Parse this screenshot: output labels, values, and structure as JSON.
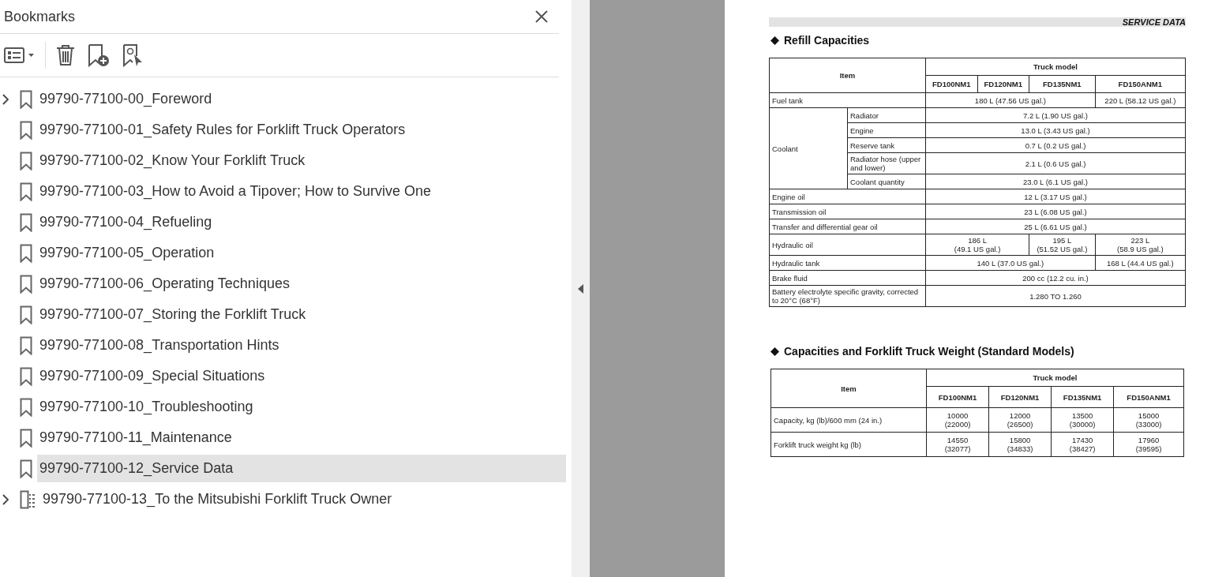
{
  "panel": {
    "title": "Bookmarks"
  },
  "bookmarks": [
    {
      "label": "99790-77100-00_Foreword",
      "kind": "bookmark",
      "has_children": true,
      "selected": false
    },
    {
      "label": "99790-77100-01_Safety Rules for Forklift Truck Operators",
      "kind": "bookmark",
      "has_children": false,
      "selected": false
    },
    {
      "label": "99790-77100-02_Know Your Forklift Truck",
      "kind": "bookmark",
      "has_children": false,
      "selected": false
    },
    {
      "label": "99790-77100-03_How to Avoid a Tipover; How to Survive One",
      "kind": "bookmark",
      "has_children": false,
      "selected": false
    },
    {
      "label": "99790-77100-04_Refueling",
      "kind": "bookmark",
      "has_children": false,
      "selected": false
    },
    {
      "label": "99790-77100-05_Operation",
      "kind": "bookmark",
      "has_children": false,
      "selected": false
    },
    {
      "label": "99790-77100-06_Operating Techniques",
      "kind": "bookmark",
      "has_children": false,
      "selected": false
    },
    {
      "label": "99790-77100-07_Storing the Forklift Truck",
      "kind": "bookmark",
      "has_children": false,
      "selected": false
    },
    {
      "label": "99790-77100-08_Transportation Hints",
      "kind": "bookmark",
      "has_children": false,
      "selected": false
    },
    {
      "label": "99790-77100-09_Special Situations",
      "kind": "bookmark",
      "has_children": false,
      "selected": false
    },
    {
      "label": "99790-77100-10_Troubleshooting",
      "kind": "bookmark",
      "has_children": false,
      "selected": false
    },
    {
      "label": "99790-77100-11_Maintenance",
      "kind": "bookmark",
      "has_children": false,
      "selected": false
    },
    {
      "label": "99790-77100-12_Service Data",
      "kind": "bookmark",
      "has_children": false,
      "selected": true
    },
    {
      "label": "99790-77100-13_To the Mitsubishi Forklift Truck Owner",
      "kind": "document",
      "has_children": true,
      "selected": false
    }
  ],
  "document": {
    "header": "SERVICE DATA",
    "refill": {
      "heading": "Refill Capacities",
      "item_header": "Item",
      "group_header": "Truck model",
      "models": [
        "FD100NM1",
        "FD120NM1",
        "FD135NM1",
        "FD150ANM1"
      ],
      "rows": [
        {
          "label": "Fuel tank",
          "values": [
            "180 L (47.56 US gal.)",
            "220 L (58.12 US gal.)"
          ]
        },
        {
          "label": "Coolant",
          "children": [
            {
              "label": "Radiator",
              "values": [
                "7.2 L (1.90 US gal.)"
              ]
            },
            {
              "label": "Engine",
              "values": [
                "13.0 L (3.43 US gal.)"
              ]
            },
            {
              "label": "Reserve tank",
              "values": [
                "0.7 L (0.2 US gal.)"
              ]
            },
            {
              "label": "Radiator hose (upper and lower)",
              "values": [
                "2.1 L (0.6 US gal.)"
              ]
            },
            {
              "label": "Coolant quantity",
              "values": [
                "23.0 L (6.1 US gal.)"
              ]
            }
          ]
        },
        {
          "label": "Engine oil",
          "values": [
            "12 L (3.17 US gal.)"
          ]
        },
        {
          "label": "Transmission oil",
          "values": [
            "23 L (6.08 US gal.)"
          ]
        },
        {
          "label": "Transfer and differential gear oil",
          "values": [
            "25 L (6.61 US gal.)"
          ]
        },
        {
          "label": "Hydraulic oil",
          "values": [
            "186 L\n(49.1 US gal.)",
            "195 L\n(51.52 US gal.)",
            "223 L\n(58.9 US gal.)"
          ]
        },
        {
          "label": "Hydraulic tank",
          "values": [
            "140 L (37.0 US gal.)",
            "168 L (44.4 US gal.)"
          ]
        },
        {
          "label": "Brake fluid",
          "values": [
            "200 cc (12.2 cu. in.)"
          ]
        },
        {
          "label": "Battery electrolyte specific gravity, corrected to 20°C (68°F)",
          "values": [
            "1.280 TO 1.260"
          ]
        }
      ]
    },
    "weights": {
      "heading": "Capacities and Forklift Truck Weight (Standard Models)",
      "item_header": "Item",
      "group_header": "Truck model",
      "models": [
        "FD100NM1",
        "FD120NM1",
        "FD135NM1",
        "FD150ANM1"
      ],
      "rows": [
        {
          "label": "Capacity, kg (lb)/600 mm (24 in.)",
          "values": [
            "10000\n(22000)",
            "12000\n(26500)",
            "13500\n(30000)",
            "15000\n(33000)"
          ]
        },
        {
          "label": "Forklift truck weight   kg (lb)",
          "values": [
            "14550\n(32077)",
            "15800\n(34833)",
            "17430\n(38427)",
            "17960\n(39595)"
          ]
        }
      ]
    }
  }
}
